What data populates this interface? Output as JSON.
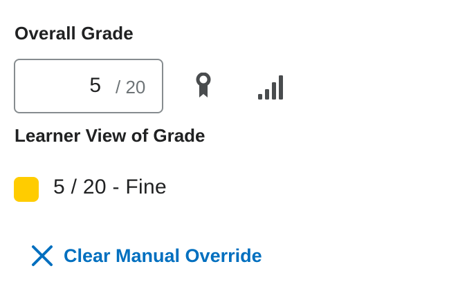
{
  "overall_grade": {
    "heading": "Overall Grade",
    "value": "5",
    "out_of": "/ 20"
  },
  "icons": {
    "award": "award-ribbon-icon",
    "statistics": "signal-bars-icon"
  },
  "learner_view": {
    "heading": "Learner View of Grade",
    "grade_text": "5 / 20 - Fine",
    "swatch_color": "#ffcc00"
  },
  "clear_override": {
    "label": "Clear Manual Override",
    "color": "#006fbf"
  }
}
